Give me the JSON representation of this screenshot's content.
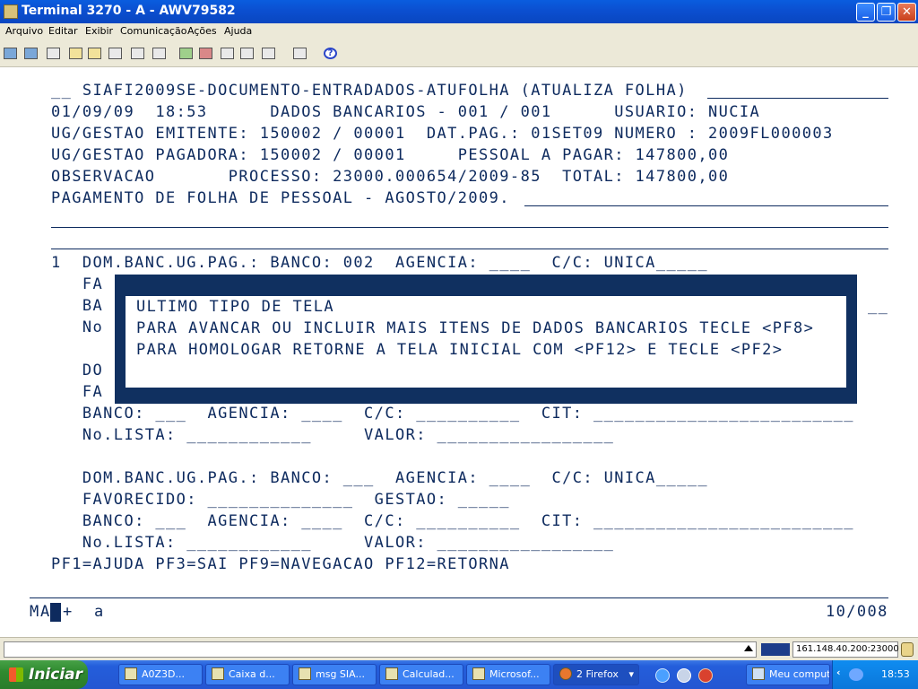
{
  "window": {
    "title": "Terminal 3270 - A - AWV79582",
    "buttons": {
      "minimize": "_",
      "maximize": "❐",
      "close": "✕"
    }
  },
  "menu": [
    "Arquivo",
    "Editar",
    "Exibir",
    "Comunicação",
    "Ações",
    "Ajuda"
  ],
  "toolbar_icons": [
    "print-icon",
    "print-setup-icon",
    "receive-icon",
    "copy-icon",
    "paste-icon",
    "copy-append-icon",
    "macro-icon",
    "keypad-icon",
    "send-file-icon",
    "receive-file-icon",
    "disconnect-icon",
    "connect-icon",
    "display-icon",
    "settings-icon",
    "help-icon"
  ],
  "terminal": {
    "lines": {
      "l1": "__ SIAFI2009SE-DOCUMENTO-ENTRADADOS-ATUFOLHA (ATUALIZA FOLHA)",
      "l2": "01/09/09  18:53      DADOS BANCARIOS - 001 / 001      USUARIO: NUCIA",
      "l3": "UG/GESTAO EMITENTE: 150002 / 00001  DAT.PAG.: 01SET09 NUMERO : 2009FL000003",
      "l4": "UG/GESTAO PAGADORA: 150002 / 00001     PESSOAL A PAGAR: 147800,00",
      "l5": "OBSERVACAO       PROCESSO: 23000.000654/2009-85  TOTAL: 147800,00",
      "l6": "PAGAMENTO DE FOLHA DE PESSOAL - AGOSTO/2009.",
      "l9": "1  DOM.BANC.UG.PAG.: BANCO: 002  AGENCIA: ____  C/C: UNICA_____",
      "l10": "   FA",
      "l11": "   BA",
      "l12": "   No",
      "l14": "   DO",
      "l15": "   FA",
      "l16": "   BANCO: ___  AGENCIA: ____  C/C: __________  CIT: _________________________",
      "l17": "   No.LISTA: ____________     VALOR: _________________",
      "l19": "   DOM.BANC.UG.PAG.: BANCO: ___  AGENCIA: ____  C/C: UNICA_____",
      "l20": "   FAVORECIDO: ______________  GESTAO: _____",
      "l21": "   BANCO: ___  AGENCIA: ____  C/C: __________  CIT: _________________________",
      "l22": "   No.LISTA: ____________     VALOR: _________________",
      "l23": "PF1=AJUDA PF3=SAI PF9=NAVEGACAO PF12=RETORNA",
      "tail_l11": "__"
    },
    "popup": {
      "line1": "ULTIMO TIPO DE TELA",
      "line2": "PARA AVANCAR OU INCLUIR MAIS ITENS DE DADOS BANCARIOS TECLE <PF8>",
      "line3": "PARA HOMOLOGAR RETORNE A TELA INICIAL COM <PF12> E TECLE <PF2>"
    },
    "oia": {
      "left1": "M",
      "left2": "A",
      "mid": "+",
      "mode": "a",
      "position": "10/008"
    }
  },
  "statusbar": {
    "host": "161.148.40.200:23000"
  },
  "taskbar": {
    "start": "Iniciar",
    "tasks": [
      "A0Z3D...",
      "Caixa d...",
      "msg SIA...",
      "Calculad...",
      "Microsof...",
      "2 Firefox",
      "Meu computa..."
    ],
    "clock": "18:53"
  }
}
